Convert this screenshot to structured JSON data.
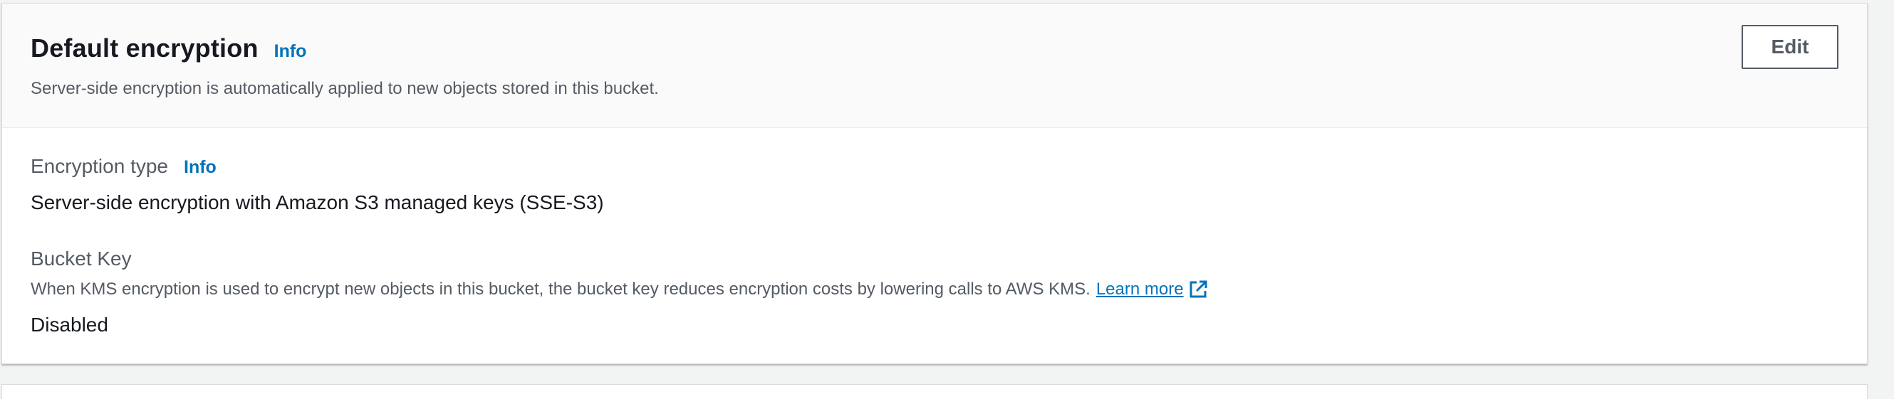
{
  "header": {
    "title": "Default encryption",
    "info_label": "Info",
    "description": "Server-side encryption is automatically applied to new objects stored in this bucket.",
    "edit_label": "Edit"
  },
  "encryption_type": {
    "label": "Encryption type",
    "info_label": "Info",
    "value": "Server-side encryption with Amazon S3 managed keys (SSE-S3)"
  },
  "bucket_key": {
    "label": "Bucket Key",
    "help": "When KMS encryption is used to encrypt new objects in this bucket, the bucket key reduces encryption costs by lowering calls to AWS KMS.",
    "learn_more": "Learn more",
    "learn_more_icon": "external-link-icon",
    "value": "Disabled"
  },
  "colors": {
    "link": "#0073bb",
    "text": "#16191f",
    "secondary_text": "#545b64",
    "header_bg": "#fafafa",
    "page_bg": "#f2f3f3"
  }
}
